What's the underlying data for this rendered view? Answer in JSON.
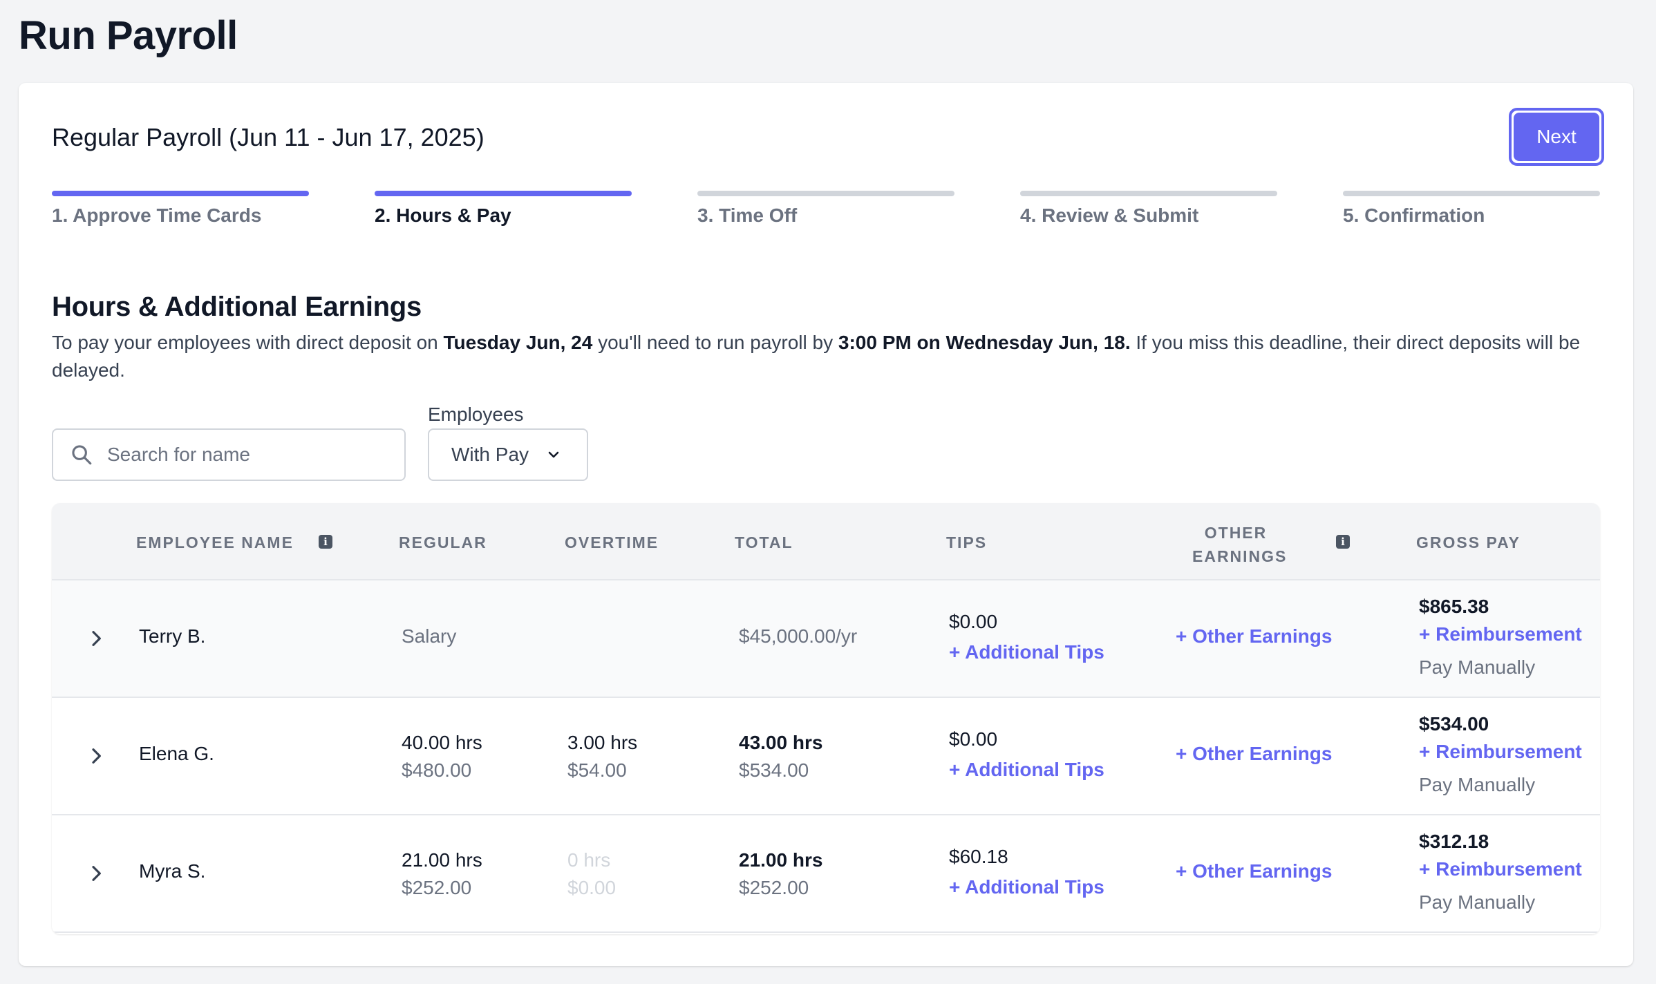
{
  "page_title": "Run Payroll",
  "payroll": {
    "title": "Regular Payroll (Jun 11 - Jun 17, 2025)",
    "next_label": "Next"
  },
  "steps": [
    {
      "label": "1. Approve Time Cards",
      "state": "done"
    },
    {
      "label": "2. Hours & Pay",
      "state": "current"
    },
    {
      "label": "3. Time Off",
      "state": "upcoming"
    },
    {
      "label": "4. Review & Submit",
      "state": "upcoming"
    },
    {
      "label": "5. Confirmation",
      "state": "upcoming"
    }
  ],
  "section": {
    "title": "Hours & Additional Earnings",
    "desc_1": "To pay your employees with direct deposit on ",
    "desc_date": "Tuesday Jun, 24",
    "desc_2": " you'll need to run payroll by ",
    "desc_deadline": "3:00 PM on Wednesday Jun, 18.",
    "desc_3": " If you miss this deadline, their direct deposits will be delayed."
  },
  "search": {
    "placeholder": "Search for name"
  },
  "filter": {
    "label": "Employees",
    "value": "With Pay"
  },
  "table": {
    "headers": {
      "name": "Employee Name",
      "regular": "Regular",
      "overtime": "Overtime",
      "total": "Total",
      "tips": "Tips",
      "other_line1": "Other",
      "other_line2": "Earnings",
      "gross": "Gross Pay"
    },
    "rows": [
      {
        "name": "Terry B.",
        "regular": "Salary",
        "total": "$45,000.00/yr",
        "tips": "$0.00",
        "tips_link": "+ Additional Tips",
        "other_link": "+ Other Earnings",
        "gross": "$865.38",
        "reimb_link": "+ Reimbursement",
        "pay_manually": "Pay Manually"
      },
      {
        "name": "Elena G.",
        "regular_hrs": "40.00 hrs",
        "regular_amt": "$480.00",
        "ot_hrs": "3.00 hrs",
        "ot_amt": "$54.00",
        "total_hrs": "43.00 hrs",
        "total_amt": "$534.00",
        "tips": "$0.00",
        "tips_link": "+ Additional Tips",
        "other_link": "+ Other Earnings",
        "gross": "$534.00",
        "reimb_link": "+ Reimbursement",
        "pay_manually": "Pay Manually"
      },
      {
        "name": "Myra S.",
        "regular_hrs": "21.00 hrs",
        "regular_amt": "$252.00",
        "ot_hrs": "0 hrs",
        "ot_amt": "$0.00",
        "total_hrs": "21.00 hrs",
        "total_amt": "$252.00",
        "tips": "$60.18",
        "tips_link": "+ Additional Tips",
        "other_link": "+ Other Earnings",
        "gross": "$312.18",
        "reimb_link": "+ Reimbursement",
        "pay_manually": "Pay Manually"
      }
    ]
  },
  "colors": {
    "accent": "#6366f1",
    "text": "#111827",
    "muted": "#6b7280",
    "border": "#d1d5db"
  }
}
